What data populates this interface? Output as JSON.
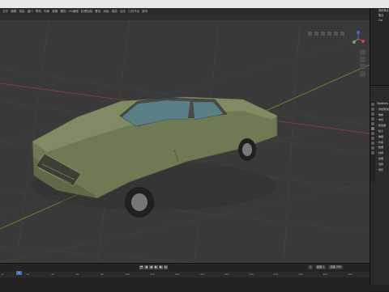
{
  "menu": {
    "items": [
      "文件",
      "编辑",
      "渲染",
      "窗口",
      "帮助",
      "布局",
      "建模",
      "雕刻",
      "UV编辑",
      "纹理绘制",
      "着色",
      "动画",
      "渲染",
      "合成",
      "几何节点",
      "脚本"
    ]
  },
  "viewport": {
    "view_label": "User",
    "gizmo_axes": {
      "x": "X",
      "y": "Y",
      "z": "Z"
    }
  },
  "outliner": {
    "rows": [
      "场景集合",
      "集合",
      "Car"
    ]
  },
  "properties": {
    "header": "Modifiers",
    "rows": [
      "添加修改器",
      "物体",
      "布线",
      "修改器",
      "粒子",
      "物理",
      "约束",
      "数据",
      "材质",
      "纹理",
      "世界",
      "场景"
    ]
  },
  "timeline": {
    "playback": [
      "⏮",
      "◀",
      "◀",
      "▶",
      "▶",
      "⏭"
    ],
    "start_label": "起始",
    "start_value": "1",
    "end_label": "结束",
    "end_value": "250",
    "current_frame": "1",
    "ruler_ticks": [
      "0",
      "20",
      "40",
      "60",
      "80",
      "100",
      "120",
      "140",
      "160",
      "180",
      "200",
      "220",
      "240",
      "260",
      "280"
    ]
  },
  "colors": {
    "axis_x": "#8b3a3a",
    "axis_y": "#6c8a2a",
    "car_body": "#6f7a55",
    "car_roof": "#4a4a44",
    "glass": "#5b7f86"
  }
}
